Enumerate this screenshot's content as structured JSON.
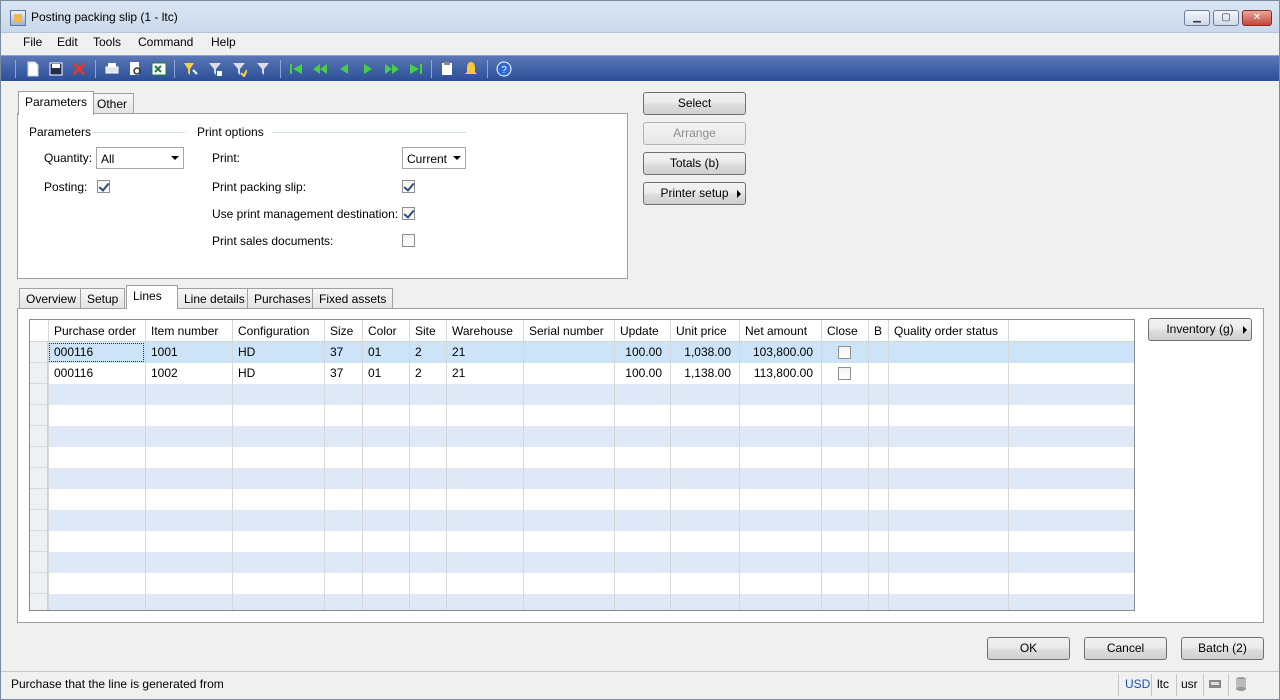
{
  "window": {
    "title": "Posting packing slip (1 - ltc)"
  },
  "menu": [
    "File",
    "Edit",
    "Tools",
    "Command",
    "Help"
  ],
  "toolbar_icons": [
    "new-icon",
    "save-icon",
    "delete-icon",
    "print-icon",
    "print-preview-icon",
    "excel-icon",
    "filter-by-selection-icon",
    "filter-by-grid-icon",
    "advanced-filter-icon",
    "remove-filter-icon",
    "first-record-icon",
    "previous-page-icon",
    "previous-record-icon",
    "next-record-icon",
    "next-page-icon",
    "last-record-icon",
    "document-handling-icon",
    "alert-icon",
    "help-icon"
  ],
  "top_tabs": [
    "Parameters",
    "Other"
  ],
  "parameters": {
    "group_title": "Parameters",
    "quantity_label": "Quantity:",
    "quantity_value": "All",
    "posting_label": "Posting:",
    "posting_checked": true
  },
  "print_options": {
    "group_title": "Print options",
    "print_label": "Print:",
    "print_value": "Current",
    "print_packing_slip_label": "Print packing slip:",
    "print_packing_slip_checked": true,
    "use_print_mgmt_label": "Use print management destination:",
    "use_print_mgmt_checked": true,
    "print_sales_docs_label": "Print sales documents:",
    "print_sales_docs_checked": false
  },
  "side_buttons": {
    "select": "Select",
    "arrange": "Arrange",
    "totals": "Totals (b)",
    "printer_setup": "Printer setup"
  },
  "lower_tabs": [
    "Overview",
    "Setup",
    "Lines",
    "Line details",
    "Purchases",
    "Fixed assets"
  ],
  "active_lower_tab": "Lines",
  "grid": {
    "columns": [
      "Purchase order",
      "Item number",
      "Configuration",
      "Size",
      "Color",
      "Site",
      "Warehouse",
      "Serial number",
      "Update",
      "Unit price",
      "Net amount",
      "Close",
      "B",
      "Quality order status"
    ],
    "rows": [
      {
        "purchase_order": "000116",
        "item_number": "1001",
        "configuration": "HD",
        "size": "37",
        "color": "01",
        "site": "2",
        "warehouse": "21",
        "serial": "",
        "update": "100.00",
        "unit_price": "1,038.00",
        "net_amount": "103,800.00",
        "close": false,
        "b": "",
        "quality": ""
      },
      {
        "purchase_order": "000116",
        "item_number": "1002",
        "configuration": "HD",
        "size": "37",
        "color": "01",
        "site": "2",
        "warehouse": "21",
        "serial": "",
        "update": "100.00",
        "unit_price": "1,138.00",
        "net_amount": "113,800.00",
        "close": false,
        "b": "",
        "quality": ""
      }
    ]
  },
  "inventory_button": "Inventory (g)",
  "footer_buttons": {
    "ok": "OK",
    "cancel": "Cancel",
    "batch": "Batch (2)"
  },
  "status_bar": {
    "text": "Purchase that the line is generated from",
    "currency": "USD",
    "company": "ltc",
    "user": "usr"
  },
  "colors": {
    "toolbar": "#2c4f98",
    "selected_row": "#cde3f7",
    "alt_row": "#dfe8f6",
    "status_link": "#1f4fb2"
  }
}
